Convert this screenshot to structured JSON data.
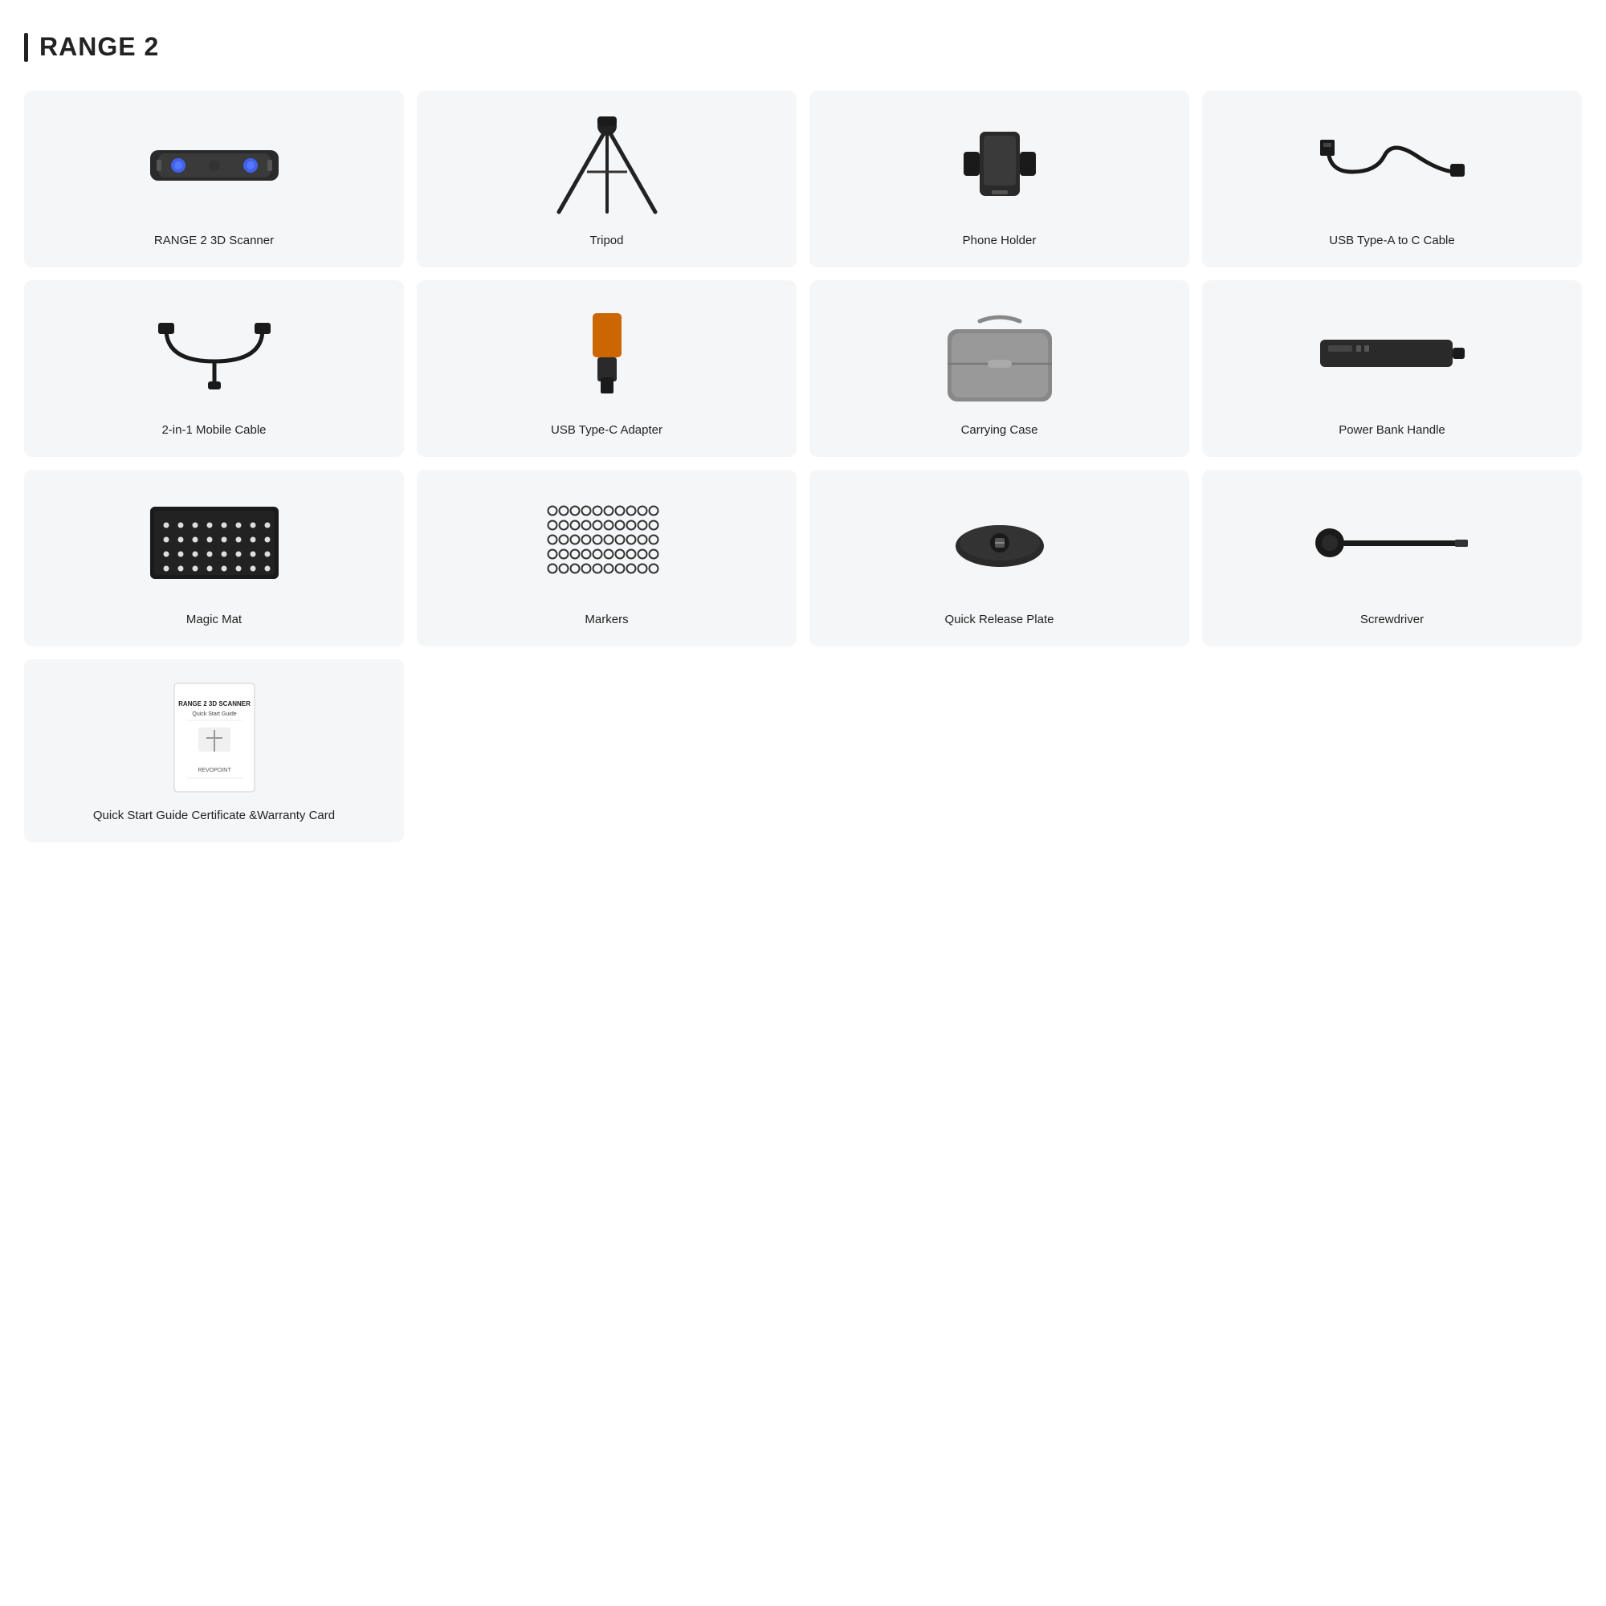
{
  "header": {
    "title": "RANGE 2"
  },
  "items": [
    {
      "id": "scanner",
      "label": "RANGE 2 3D Scanner",
      "icon": "scanner"
    },
    {
      "id": "tripod",
      "label": "Tripod",
      "icon": "tripod"
    },
    {
      "id": "phone-holder",
      "label": "Phone Holder",
      "icon": "phone-holder"
    },
    {
      "id": "usb-a-c",
      "label": "USB Type-A to C\nCable",
      "icon": "usb-cable"
    },
    {
      "id": "mobile-cable",
      "label": "2-in-1\nMobile Cable",
      "icon": "mobile-cable"
    },
    {
      "id": "usb-c-adapter",
      "label": "USB Type-C\nAdapter",
      "icon": "usb-adapter"
    },
    {
      "id": "carrying-case",
      "label": "Carrying Case",
      "icon": "carrying-case"
    },
    {
      "id": "power-bank",
      "label": "Power Bank Handle",
      "icon": "power-bank"
    },
    {
      "id": "magic-mat",
      "label": "Magic Mat",
      "icon": "magic-mat"
    },
    {
      "id": "markers",
      "label": "Markers",
      "icon": "markers"
    },
    {
      "id": "quick-release",
      "label": "Quick Release Plate",
      "icon": "quick-release"
    },
    {
      "id": "screwdriver",
      "label": "Screwdriver",
      "icon": "screwdriver"
    },
    {
      "id": "quick-start",
      "label": "Quick Start Guide\nCertificate &Warranty Card",
      "icon": "quick-start"
    }
  ]
}
